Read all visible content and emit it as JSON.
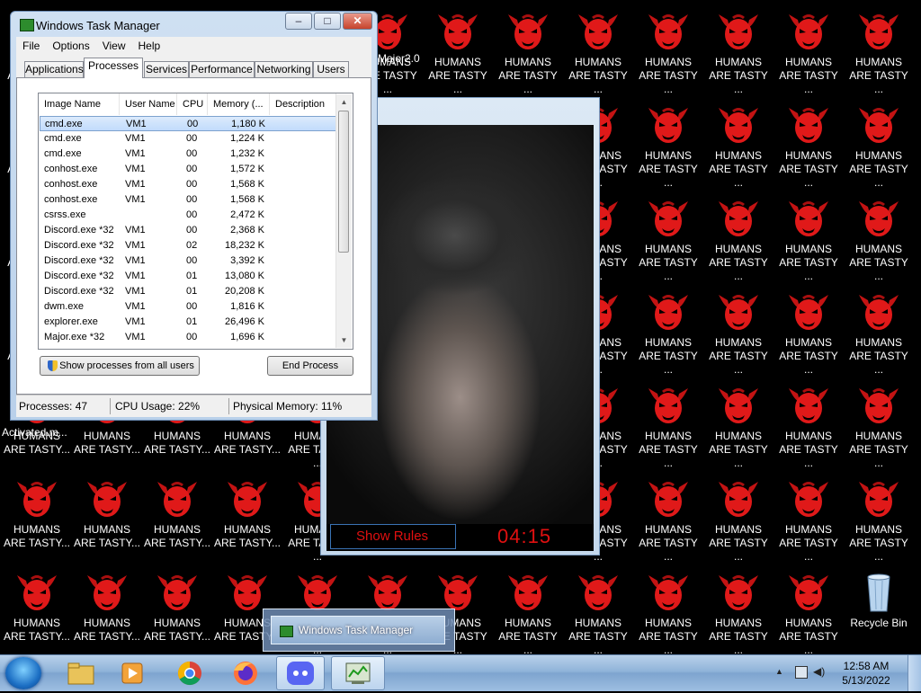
{
  "desktop": {
    "icon_label": "HUMANS\nARE TASTY ...",
    "icon_label_short": "HUMANS\nARE TASTY...",
    "partial_labels": {
      "major": "Major2.0",
      "activated": "Activated.m..."
    },
    "recycle_bin": "Recycle Bin",
    "colors": {
      "background": "#000000",
      "devil_red": "#e01919"
    }
  },
  "horror_window": {
    "show_rules": "Show Rules",
    "timer": "04:15",
    "accent_color": "#e01010"
  },
  "task_manager": {
    "title": "Windows Task Manager",
    "caption_buttons": {
      "minimize": "–",
      "maximize": "□",
      "close": "✕"
    },
    "menu": [
      "File",
      "Options",
      "View",
      "Help"
    ],
    "tabs": [
      "Applications",
      "Processes",
      "Services",
      "Performance",
      "Networking",
      "Users"
    ],
    "active_tab": "Processes",
    "columns": [
      "Image Name",
      "User Name",
      "CPU",
      "Memory (...",
      "Description"
    ],
    "rows": [
      {
        "name": "cmd.exe",
        "user": "VM1",
        "cpu": "00",
        "mem": "1,180 K"
      },
      {
        "name": "cmd.exe",
        "user": "VM1",
        "cpu": "00",
        "mem": "1,224 K"
      },
      {
        "name": "cmd.exe",
        "user": "VM1",
        "cpu": "00",
        "mem": "1,232 K"
      },
      {
        "name": "conhost.exe",
        "user": "VM1",
        "cpu": "00",
        "mem": "1,572 K"
      },
      {
        "name": "conhost.exe",
        "user": "VM1",
        "cpu": "00",
        "mem": "1,568 K"
      },
      {
        "name": "conhost.exe",
        "user": "VM1",
        "cpu": "00",
        "mem": "1,568 K"
      },
      {
        "name": "csrss.exe",
        "user": "",
        "cpu": "00",
        "mem": "2,472 K"
      },
      {
        "name": "Discord.exe *32",
        "user": "VM1",
        "cpu": "00",
        "mem": "2,368 K"
      },
      {
        "name": "Discord.exe *32",
        "user": "VM1",
        "cpu": "02",
        "mem": "18,232 K"
      },
      {
        "name": "Discord.exe *32",
        "user": "VM1",
        "cpu": "00",
        "mem": "3,392 K"
      },
      {
        "name": "Discord.exe *32",
        "user": "VM1",
        "cpu": "01",
        "mem": "13,080 K"
      },
      {
        "name": "Discord.exe *32",
        "user": "VM1",
        "cpu": "01",
        "mem": "20,208 K"
      },
      {
        "name": "dwm.exe",
        "user": "VM1",
        "cpu": "00",
        "mem": "1,816 K"
      },
      {
        "name": "explorer.exe",
        "user": "VM1",
        "cpu": "01",
        "mem": "26,496 K"
      },
      {
        "name": "Major.exe *32",
        "user": "VM1",
        "cpu": "00",
        "mem": "1,696 K"
      }
    ],
    "show_all_button": "Show processes from all users",
    "end_process_button": "End Process",
    "status": {
      "processes": "Processes: 47",
      "cpu": "CPU Usage: 22%",
      "memory": "Physical Memory: 11%"
    }
  },
  "taskbar": {
    "thumbnail_title": "Windows Task Manager",
    "pinned": [
      "start-orb-icon",
      "file-explorer-icon",
      "media-player-icon",
      "chrome-icon",
      "firefox-icon",
      "discord-icon",
      "task-manager-icon"
    ],
    "clock_time": "12:58 AM",
    "clock_date": "5/13/2022"
  }
}
